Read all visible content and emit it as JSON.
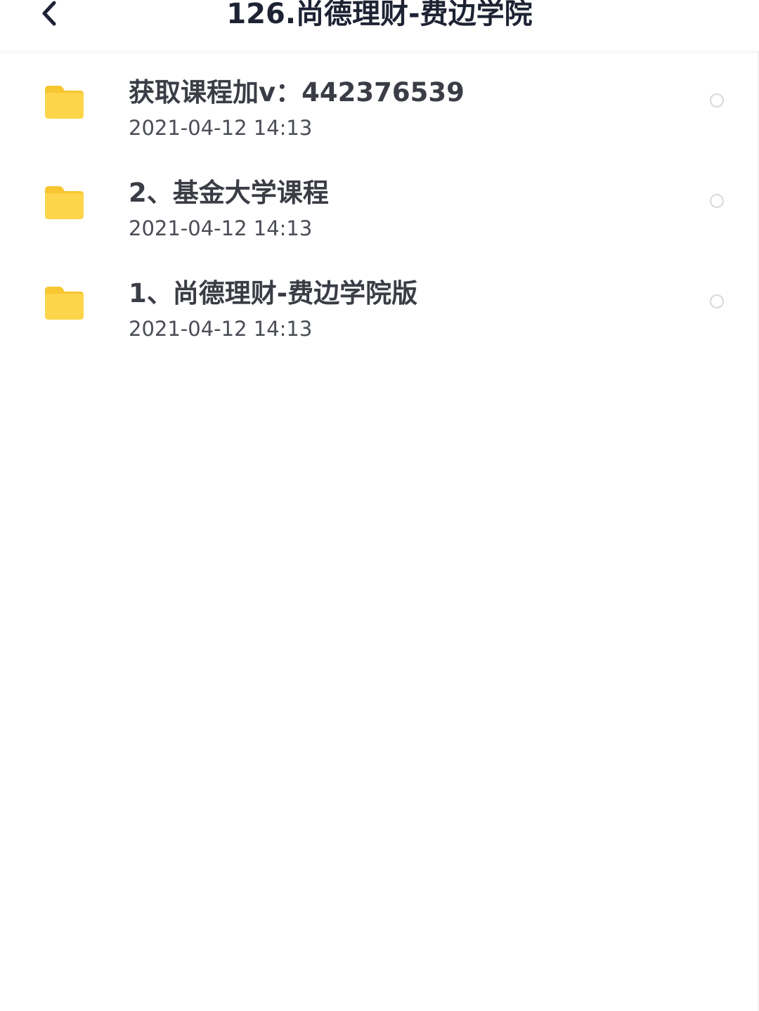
{
  "header": {
    "title": "126.尚德理财-费边学院",
    "back_icon": "chevron-left-icon"
  },
  "colors": {
    "folder": "#fdd54a",
    "folder_tab": "#f7c631",
    "title_text": "#1d2333",
    "item_text": "#3a3d45",
    "date_text": "#4a4d55",
    "radio_border": "#d8d8d8"
  },
  "items": [
    {
      "name": "获取课程加v：442376539",
      "date": "2021-04-12 14:13",
      "icon": "folder-icon"
    },
    {
      "name": "2、基金大学课程",
      "date": "2021-04-12 14:13",
      "icon": "folder-icon"
    },
    {
      "name": "1、尚德理财-费边学院版",
      "date": "2021-04-12 14:13",
      "icon": "folder-icon"
    }
  ]
}
